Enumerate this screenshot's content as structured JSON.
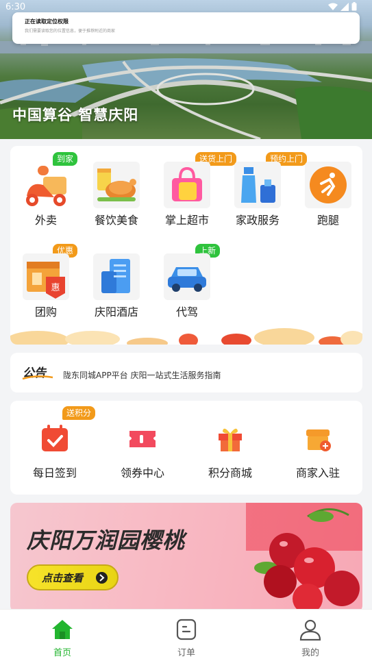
{
  "status_bar": {
    "time": "6:30"
  },
  "toast": {
    "title": "正在读取定位权限",
    "message": "我们需要读取您的位置信息，便于推荐附近的商家"
  },
  "hero": {
    "slogan": "中国算谷  智慧庆阳"
  },
  "services": [
    {
      "label": "外卖",
      "badge": "到家",
      "badge_color": "#2fc33d",
      "icon": "scooter-icon"
    },
    {
      "label": "餐饮美食",
      "badge": "",
      "icon": "roast-chicken-icon"
    },
    {
      "label": "掌上超市",
      "badge": "送货上门",
      "badge_color": "#f29a1a",
      "icon": "shopping-bag-icon"
    },
    {
      "label": "家政服务",
      "badge": "预约上门",
      "badge_color": "#f29a1a",
      "icon": "cleaning-spray-icon"
    },
    {
      "label": "跑腿",
      "badge": "",
      "icon": "runner-icon"
    },
    {
      "label": "团购",
      "badge": "优惠",
      "badge_color": "#f29a1a",
      "icon": "store-coupon-icon"
    },
    {
      "label": "庆阳酒店",
      "badge": "",
      "icon": "hotel-building-icon"
    },
    {
      "label": "代驾",
      "badge": "上新",
      "badge_color": "#2fc33d",
      "icon": "car-icon"
    }
  ],
  "notice": {
    "logo_text": "公告",
    "text": "陇东同城APP平台 庆阳一站式生活服务指南"
  },
  "actions": [
    {
      "label": "每日签到",
      "badge": "送积分",
      "icon": "calendar-check-icon"
    },
    {
      "label": "领券中心",
      "badge": "",
      "icon": "ticket-icon"
    },
    {
      "label": "积分商城",
      "badge": "",
      "icon": "gift-icon"
    },
    {
      "label": "商家入驻",
      "badge": "",
      "icon": "shop-add-icon"
    }
  ],
  "promo": {
    "title": "庆阳万润园樱桃",
    "button_label": "点击查看"
  },
  "tabs": [
    {
      "label": "首页",
      "active": true,
      "icon": "home-icon"
    },
    {
      "label": "订单",
      "active": false,
      "icon": "order-icon"
    },
    {
      "label": "我的",
      "active": false,
      "icon": "user-icon"
    }
  ],
  "colors": {
    "accent_green": "#23b52f",
    "badge_orange": "#f29a1a",
    "badge_green": "#2fc33d"
  }
}
